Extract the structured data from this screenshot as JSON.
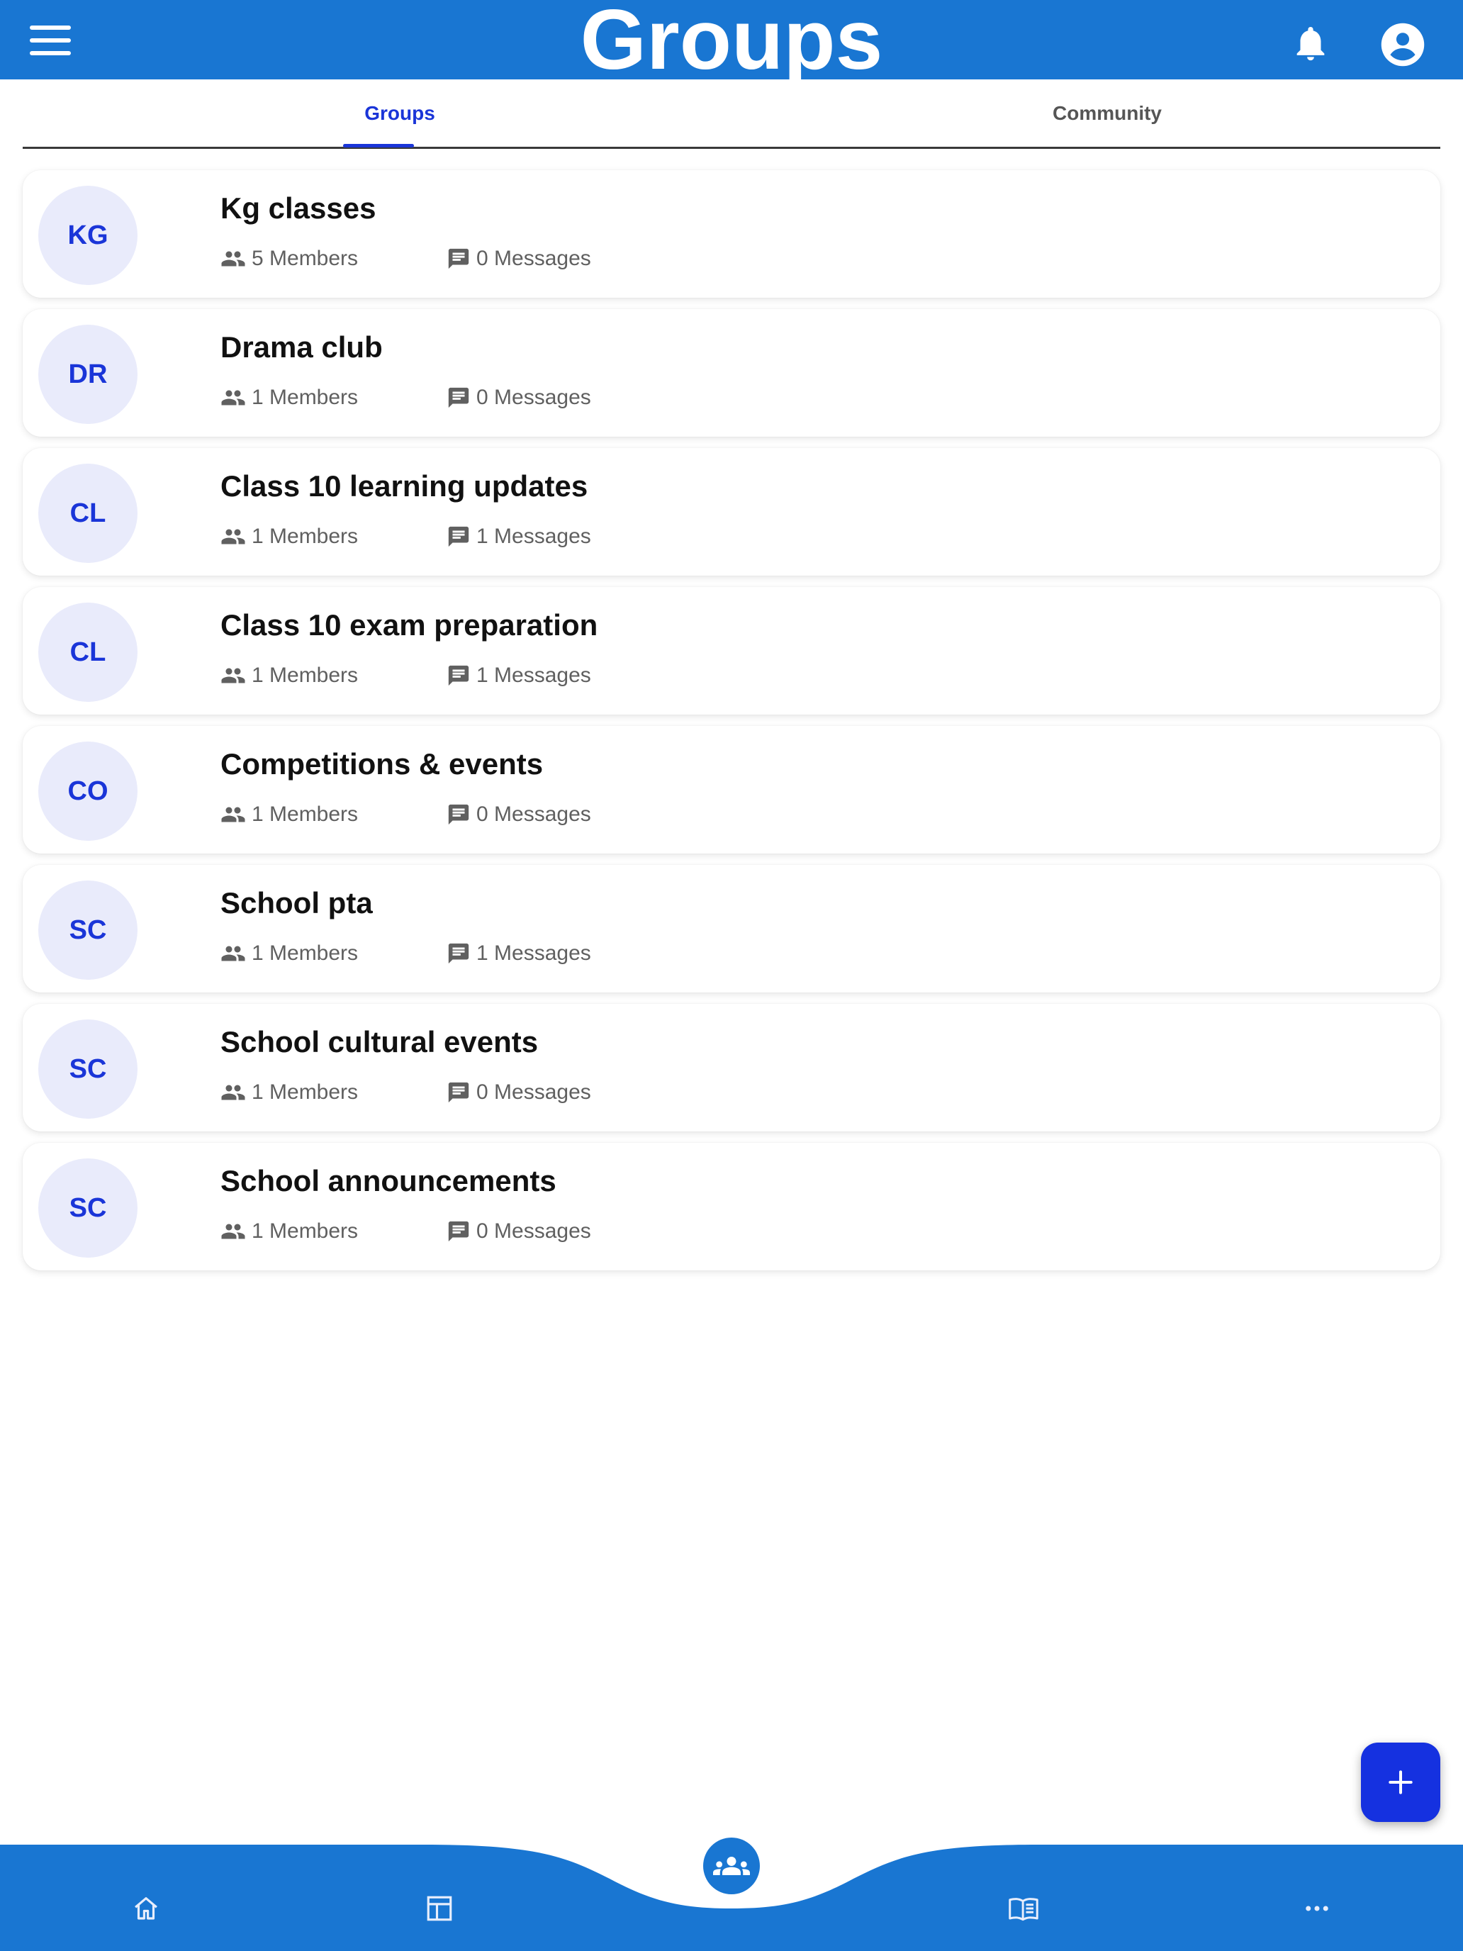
{
  "header": {
    "title": "Groups",
    "menu_icon": "menu-icon",
    "notification_icon": "bell-icon",
    "account_icon": "account-circle-icon",
    "color": "#1976D2"
  },
  "tabs": [
    {
      "label": "Groups",
      "active": true
    },
    {
      "label": "Community",
      "active": false
    }
  ],
  "groups": [
    {
      "initials": "KG",
      "name": "Kg classes",
      "members": "5 Members",
      "messages": "0 Messages"
    },
    {
      "initials": "DR",
      "name": "Drama club",
      "members": "1 Members",
      "messages": "0 Messages"
    },
    {
      "initials": "CL",
      "name": "Class 10 learning updates",
      "members": "1 Members",
      "messages": "1 Messages"
    },
    {
      "initials": "CL",
      "name": "Class 10 exam preparation",
      "members": "1 Members",
      "messages": "1 Messages"
    },
    {
      "initials": "CO",
      "name": "Competitions & events",
      "members": "1 Members",
      "messages": "0 Messages"
    },
    {
      "initials": "SC",
      "name": "School pta",
      "members": "1 Members",
      "messages": "1 Messages"
    },
    {
      "initials": "SC",
      "name": "School cultural events",
      "members": "1 Members",
      "messages": "0 Messages"
    },
    {
      "initials": "SC",
      "name": "School announcements",
      "members": "1 Members",
      "messages": "0 Messages"
    }
  ],
  "fab": {
    "icon": "plus-icon",
    "color": "#1531e0"
  },
  "bottom_nav": {
    "items": [
      {
        "icon": "home-icon"
      },
      {
        "icon": "dashboard-icon"
      },
      {
        "icon": "groups-icon",
        "active": true
      },
      {
        "icon": "library-icon"
      },
      {
        "icon": "more-horizontal-icon"
      }
    ]
  }
}
